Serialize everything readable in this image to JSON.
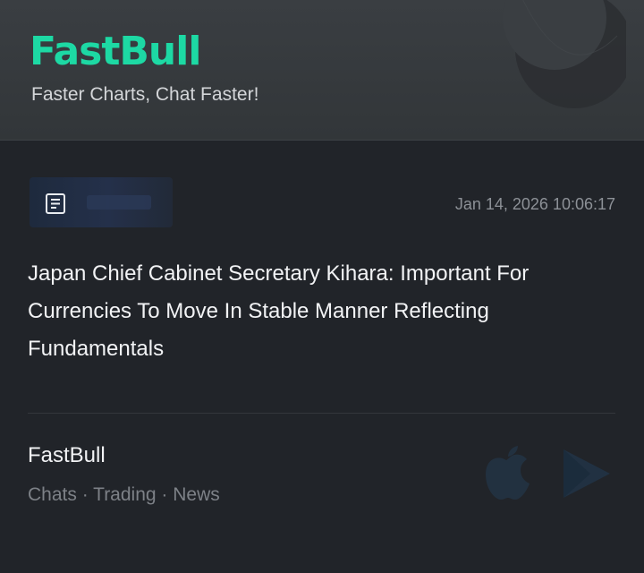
{
  "header": {
    "logo_text": "FastBull",
    "tagline": "Faster Charts, Chat Faster!"
  },
  "article": {
    "source_icon": "newspaper-icon",
    "timestamp": "Jan 14, 2026 10:06:17",
    "headline": "Japan Chief Cabinet Secretary Kihara: Important For Currencies To Move In Stable Manner Reflecting Fundamentals"
  },
  "footer": {
    "brand": "FastBull",
    "tagline": "Chats · Trading · News",
    "store_icons": [
      "apple-icon",
      "google-play-icon"
    ]
  },
  "colors": {
    "brand_accent": "#1dd9a4",
    "background": "#212429",
    "header_background": "#363a3d"
  }
}
